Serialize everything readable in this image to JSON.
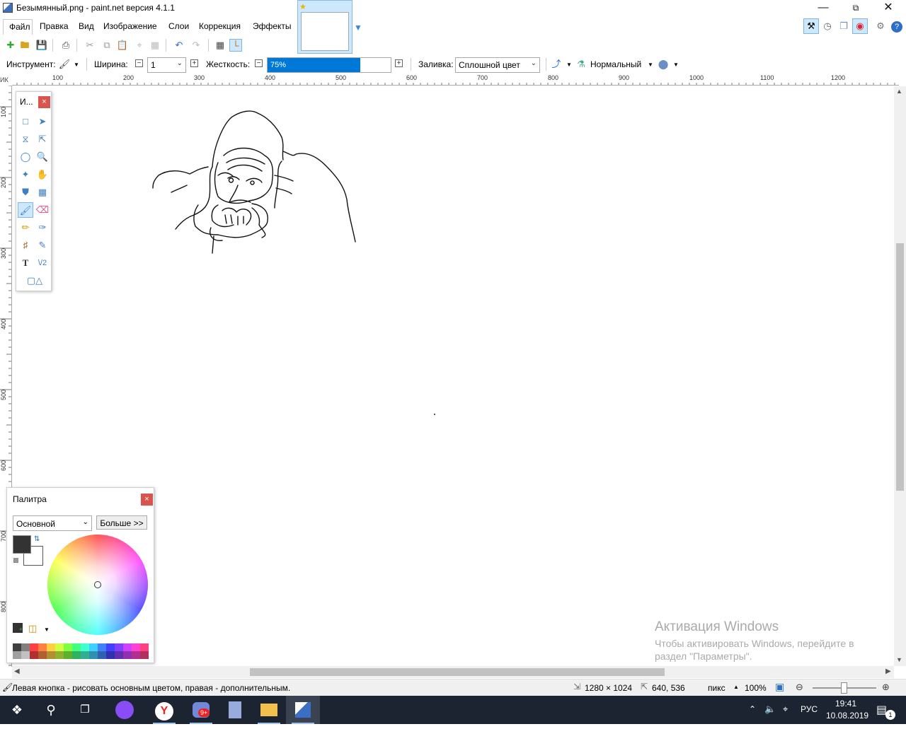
{
  "window": {
    "title": "Безымянный.png - paint.net версия 4.1.1",
    "min_icon": "minimize-icon",
    "max_icon": "restore-icon",
    "close_icon": "close-icon"
  },
  "menu": [
    "Файл",
    "Правка",
    "Вид",
    "Изображение",
    "Слои",
    "Коррекция",
    "Эффекты"
  ],
  "toolbar2": {
    "tool_label": "Инструмент:",
    "width_label": "Ширина:",
    "width_value": "1",
    "hardness_label": "Жесткость:",
    "hardness_value": "75%",
    "hardness_fraction": 0.75,
    "fill_label": "Заливка:",
    "fill_value": "Сплошной цвет",
    "blend_value": "Нормальный"
  },
  "ruler": {
    "corner": "ИК",
    "top": [
      "100",
      "200",
      "300",
      "400",
      "500",
      "600",
      "700",
      "800",
      "900",
      "1000",
      "1100",
      "1200"
    ],
    "left": [
      "100",
      "200",
      "300",
      "400",
      "500",
      "600",
      "700",
      "800"
    ]
  },
  "tools_panel": {
    "title": "И...",
    "close": "×"
  },
  "palette": {
    "title": "Палитра",
    "close": "×",
    "mode": "Основной",
    "more": "Больше >>",
    "primary": "#333333",
    "secondary": "#ffffff"
  },
  "status": {
    "hint": "Левая кнопка - рисовать основным цветом, правая - дополнительным.",
    "image_size": "1280 × 1024",
    "cursor_pos": "640, 536",
    "units": "пикс",
    "zoom": "100%"
  },
  "watermark": {
    "line1": "Активация Windows",
    "line2": "Чтобы активировать Windows, перейдите в",
    "line3": "раздел \"Параметры\"."
  },
  "taskbar": {
    "lang": "РУС",
    "time": "19:41",
    "date": "10.08.2019",
    "notif": "1",
    "badge": "9+"
  },
  "swatch_colors_top": [
    "#404040",
    "#808080",
    "#ff4040",
    "#ff8040",
    "#ffd040",
    "#d0ff40",
    "#80ff40",
    "#40ff80",
    "#40ffd0",
    "#40d0ff",
    "#4080ff",
    "#4040ff",
    "#8040ff",
    "#d040ff",
    "#ff40d0",
    "#ff4080"
  ],
  "swatch_colors_bottom": [
    "#a0a0a0",
    "#c0c0c0",
    "#b03030",
    "#b06030",
    "#b09030",
    "#90b030",
    "#60b030",
    "#30b060",
    "#30b090",
    "#3090b0",
    "#3060b0",
    "#3030b0",
    "#6030b0",
    "#9030b0",
    "#b03090",
    "#b03060"
  ]
}
